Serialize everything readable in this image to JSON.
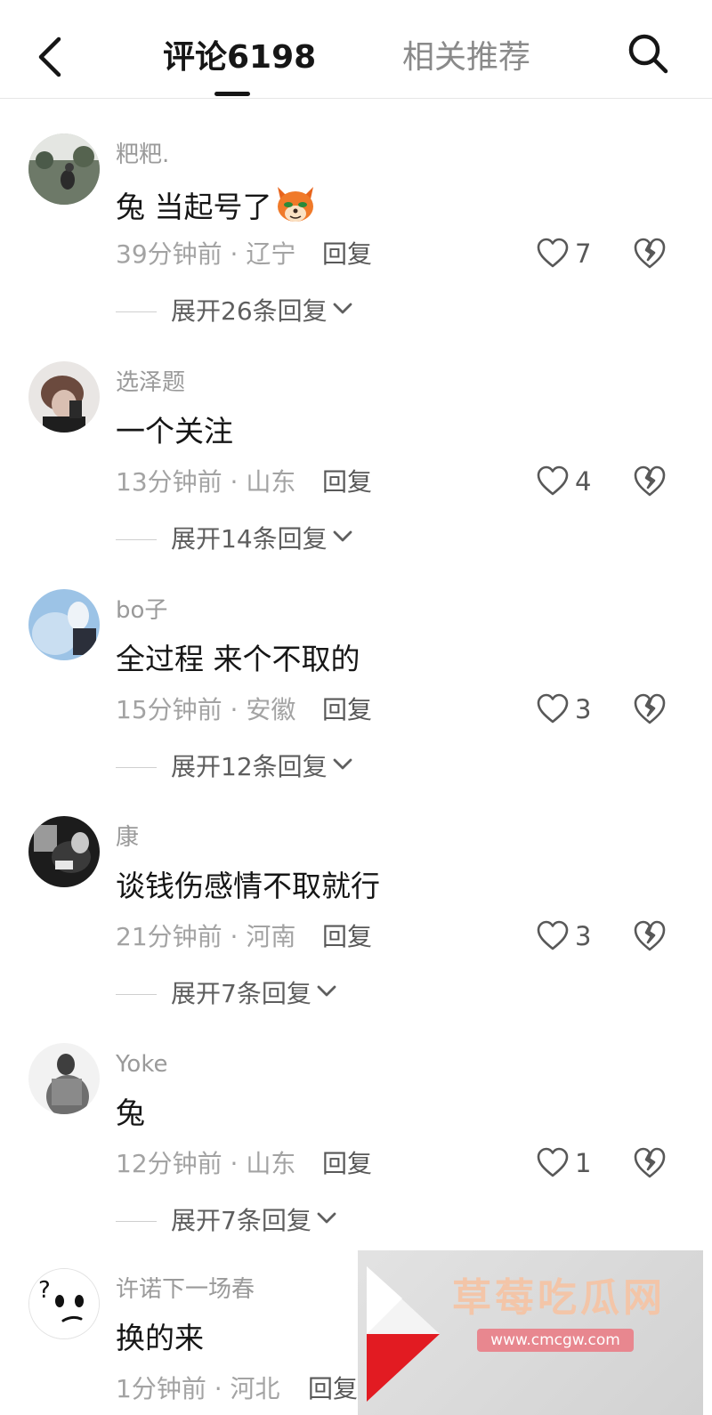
{
  "header": {
    "tab_comments": "评论6198",
    "tab_related": "相关推荐"
  },
  "comments": [
    {
      "username": "粑粑.",
      "text": "兔 当起号了",
      "emoji": "fox-face-emoji",
      "meta": "39分钟前 · 辽宁",
      "reply": "回复",
      "likes": "7",
      "expand": "展开26条回复"
    },
    {
      "username": "选泽题",
      "text": "一个关注",
      "meta": "13分钟前 · 山东",
      "reply": "回复",
      "likes": "4",
      "expand": "展开14条回复"
    },
    {
      "username": "bo子",
      "text": "全过程 来个不取的",
      "meta": "15分钟前 · 安徽",
      "reply": "回复",
      "likes": "3",
      "expand": "展开12条回复"
    },
    {
      "username": "康",
      "text": "谈钱伤感情不取就行",
      "meta": "21分钟前 · 河南",
      "reply": "回复",
      "likes": "3",
      "expand": "展开7条回复"
    },
    {
      "username": "Yoke",
      "text": "兔",
      "meta": "12分钟前 · 山东",
      "reply": "回复",
      "likes": "1",
      "expand": "展开7条回复"
    },
    {
      "username": "许诺下一场春",
      "text": "换的来",
      "meta": "1分钟前 · 河北",
      "reply": "回复"
    }
  ],
  "watermark": {
    "title": "草莓吃瓜网",
    "url": "www.cmcgw.com"
  },
  "colors": {
    "text_primary": "#161616",
    "text_secondary": "#a3a3a3",
    "divider": "#e6e6e6"
  }
}
